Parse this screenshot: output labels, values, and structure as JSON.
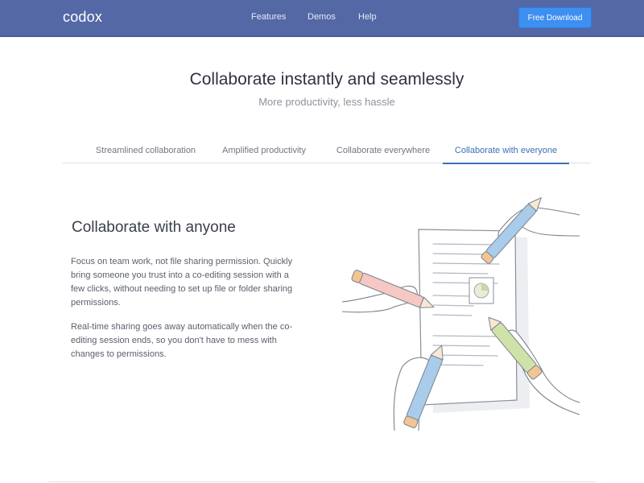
{
  "navbar": {
    "logo": "codox",
    "links": [
      "Features",
      "Demos",
      "Help"
    ],
    "download_label": "Free Download",
    "background_color": "#5468a6",
    "button_color": "#3d8ff0"
  },
  "hero": {
    "title": "Collaborate instantly and seamlessly",
    "subtitle": "More productivity, less hassle"
  },
  "tabs": {
    "items": [
      "Streamlined collaboration",
      "Amplified productivity",
      "Collaborate everywhere",
      "Collaborate with everyone"
    ],
    "active": "Collaborate with everyone",
    "active_color": "#3c6fb8"
  },
  "content": {
    "heading": "Collaborate with anyone",
    "paragraphs": [
      "Focus on team work, not file sharing permission. Quickly bring someone you trust into a co-editing session with a few clicks, without needing to set up file or folder sharing permissions.",
      "Real-time sharing goes away automatically when the co-editing session ends, so you don't have to mess with changes to permissions."
    ],
    "illustration_icon": "document-with-pencils-illustration"
  }
}
